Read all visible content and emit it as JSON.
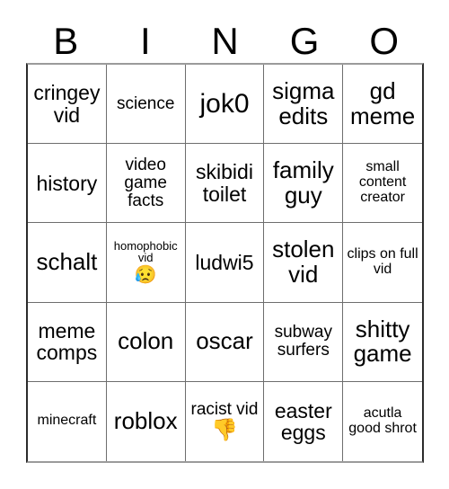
{
  "card": {
    "title": "BINGO",
    "header_letters": [
      "B",
      "I",
      "N",
      "G",
      "O"
    ],
    "grid_size": "5x5",
    "colors": {
      "background": "#ffffff",
      "text": "#000000",
      "grid_line": "#6e6e6e",
      "grid_border": "#2b2b2b",
      "emoji_yellow": "#f5c542"
    },
    "rows": [
      [
        {
          "text": "cringey vid",
          "size": "md",
          "emoji": "",
          "emoji_name": ""
        },
        {
          "text": "science",
          "size": "sm",
          "emoji": "",
          "emoji_name": ""
        },
        {
          "text": "jok0",
          "size": "xl",
          "emoji": "",
          "emoji_name": ""
        },
        {
          "text": "sigma edits",
          "size": "lg",
          "emoji": "",
          "emoji_name": ""
        },
        {
          "text": "gd meme",
          "size": "lg",
          "emoji": "",
          "emoji_name": ""
        }
      ],
      [
        {
          "text": "history",
          "size": "md",
          "emoji": "",
          "emoji_name": ""
        },
        {
          "text": "video game facts",
          "size": "sm",
          "emoji": "",
          "emoji_name": ""
        },
        {
          "text": "skibidi toilet",
          "size": "md",
          "emoji": "",
          "emoji_name": ""
        },
        {
          "text": "family guy",
          "size": "lg",
          "emoji": "",
          "emoji_name": ""
        },
        {
          "text": "small content creator",
          "size": "xs",
          "emoji": "",
          "emoji_name": ""
        }
      ],
      [
        {
          "text": "schalt",
          "size": "lg",
          "emoji": "",
          "emoji_name": ""
        },
        {
          "text": "homophobic vid",
          "size": "xxs",
          "emoji": "😥",
          "emoji_name": "sad-relieved-face-emoji"
        },
        {
          "text": "ludwi5",
          "size": "md",
          "emoji": "",
          "emoji_name": ""
        },
        {
          "text": "stolen vid",
          "size": "lg",
          "emoji": "",
          "emoji_name": ""
        },
        {
          "text": "clips on full vid",
          "size": "xs",
          "emoji": "",
          "emoji_name": ""
        }
      ],
      [
        {
          "text": "meme comps",
          "size": "md",
          "emoji": "",
          "emoji_name": ""
        },
        {
          "text": "colon",
          "size": "lg",
          "emoji": "",
          "emoji_name": ""
        },
        {
          "text": "oscar",
          "size": "lg",
          "emoji": "",
          "emoji_name": ""
        },
        {
          "text": "subway surfers",
          "size": "sm",
          "emoji": "",
          "emoji_name": ""
        },
        {
          "text": "shitty game",
          "size": "lg",
          "emoji": "",
          "emoji_name": ""
        }
      ],
      [
        {
          "text": "minecraft",
          "size": "xs",
          "emoji": "",
          "emoji_name": ""
        },
        {
          "text": "roblox",
          "size": "lg",
          "emoji": "",
          "emoji_name": ""
        },
        {
          "text": "racist vid",
          "size": "sm",
          "emoji": "👎",
          "emoji_name": "thumbs-down-emoji"
        },
        {
          "text": "easter eggs",
          "size": "md",
          "emoji": "",
          "emoji_name": ""
        },
        {
          "text": "acutla good shrot",
          "size": "xs",
          "emoji": "",
          "emoji_name": ""
        }
      ]
    ]
  }
}
